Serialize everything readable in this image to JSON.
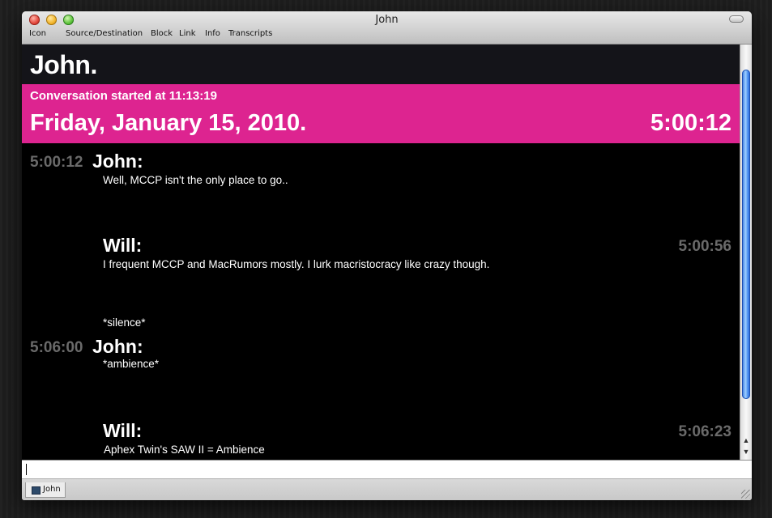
{
  "window": {
    "title": "John"
  },
  "toolbar": {
    "items": [
      "Icon",
      "Source/Destination",
      "Block",
      "Link",
      "Info",
      "Transcripts"
    ]
  },
  "chat": {
    "header_name": "John.",
    "banner": {
      "started": "Conversation started at 11:13:19",
      "date": "Friday, January 15, 2010.",
      "time": "5:00:12"
    },
    "messages": [
      {
        "time": "5:00:12",
        "sender": "John:",
        "lines": [
          "Well, MCCP isn't the only place to go.."
        ]
      },
      {
        "time": "5:00:56",
        "sender": "Will:",
        "lines": [
          "I frequent MCCP and MacRumors mostly. I lurk macristocracy like crazy though.",
          "*silence*"
        ]
      },
      {
        "time": "5:06:00",
        "sender": "John:",
        "lines": [
          "*ambience*"
        ]
      },
      {
        "time": "5:06:23",
        "sender": "Will:",
        "lines": [
          "Aphex Twin's SAW II = Ambience"
        ]
      }
    ]
  },
  "tabs": [
    {
      "label": "John"
    }
  ],
  "colors": {
    "banner": "#dd2490",
    "timestamp": "#6a6a6a",
    "scroll_thumb": "#4b8ff0"
  }
}
